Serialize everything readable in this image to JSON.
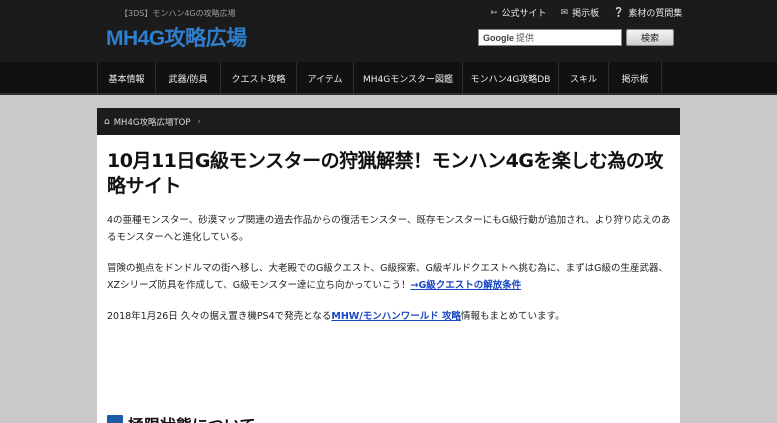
{
  "header": {
    "tagline": "【3DS】モンハン4Gの攻略広場",
    "logo": "MH4G攻略広場",
    "top_links": [
      {
        "icon": "share-icon",
        "label": "公式サイト"
      },
      {
        "icon": "chat-icon",
        "label": "掲示板"
      },
      {
        "icon": "question-icon",
        "label": "素材の質問集"
      }
    ],
    "search": {
      "placeholder": "",
      "google_label": "Google",
      "google_sub": "提供",
      "button_label": "検索"
    }
  },
  "nav": {
    "items": [
      {
        "label": "基本情報",
        "width": 58
      },
      {
        "label": "武器/防具",
        "width": 65
      },
      {
        "label": "クエスト攻略",
        "width": 76
      },
      {
        "label": "アイテム",
        "width": 57
      },
      {
        "label": "MH4Gモンスター図鑑",
        "width": 109
      },
      {
        "label": "モンハン4G攻略DB",
        "width": 96
      },
      {
        "label": "スキル",
        "width": 50
      },
      {
        "label": "掲示板",
        "width": 53
      }
    ]
  },
  "breadcrumb": {
    "label": "MH4G攻略広場TOP"
  },
  "article": {
    "title": "10月11日G級モンスターの狩猟解禁！モンハン4Gを楽しむ為の攻略サイト",
    "p1": "4の亜種モンスター、砂漠マップ関連の過去作品からの復活モンスター、既存モンスターにもG級行動が追加され、より狩り応えのあるモンスターへと進化している。",
    "p2_text": "冒険の拠点をドンドルマの街へ移し、大老殿でのG級クエスト、G級探索、G級ギルドクエストへ挑む為に、まずはG級の生産武器、XZシリーズ防具を作成して、G級モンスター達に立ち向かっていこう！",
    "p2_link": "→G級クエストの解放条件",
    "p3_pre": "2018年1月26日 久々の据え置き機PS4で発売となる",
    "p3_link": "MHW/モンハンワールド 攻略",
    "p3_post": "情報もまとめています。",
    "h2": "極限状態について"
  }
}
